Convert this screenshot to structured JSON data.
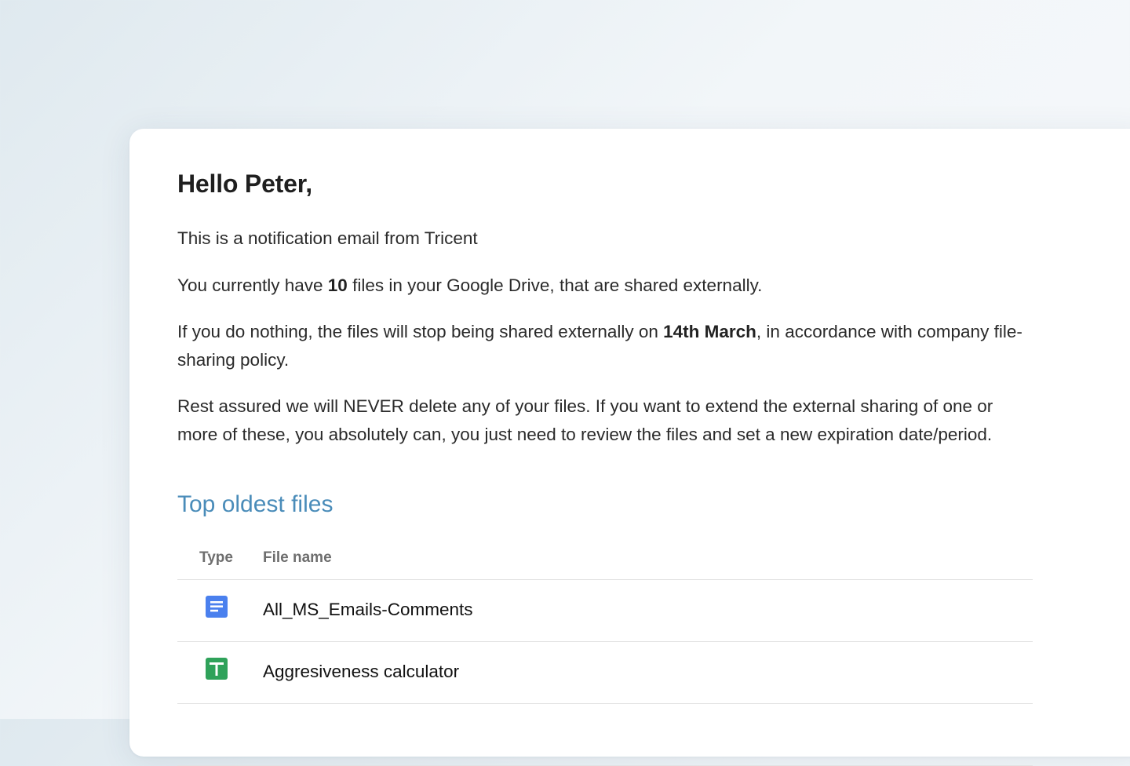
{
  "email": {
    "greeting": "Hello Peter,",
    "intro": "This is a notification email from Tricent",
    "shared_count": {
      "before": "You currently have ",
      "count": "10",
      "after": " files in your Google Drive, that are shared externally."
    },
    "stop_notice": {
      "before": "If you do nothing, the files will stop being shared externally on ",
      "date": "14th March",
      "after": ", in accordance with company file-sharing policy."
    },
    "reassurance": "Rest assured we will NEVER delete any of your files. If you want to extend the external sharing of one or more of these, you absolutely can, you just need to review the files and set a new expiration date/period.",
    "section_title": "Top oldest files",
    "table": {
      "columns": [
        "Type",
        "File name"
      ],
      "rows": [
        {
          "type_icon": "google-docs-icon",
          "file_name": "All_MS_Emails-Comments"
        },
        {
          "type_icon": "google-sheets-icon",
          "file_name": "Aggresiveness calculator"
        }
      ]
    }
  },
  "colors": {
    "section_title": "#4a8cb9",
    "docs_icon": "#4a80ee",
    "sheets_icon": "#2fa25a"
  }
}
